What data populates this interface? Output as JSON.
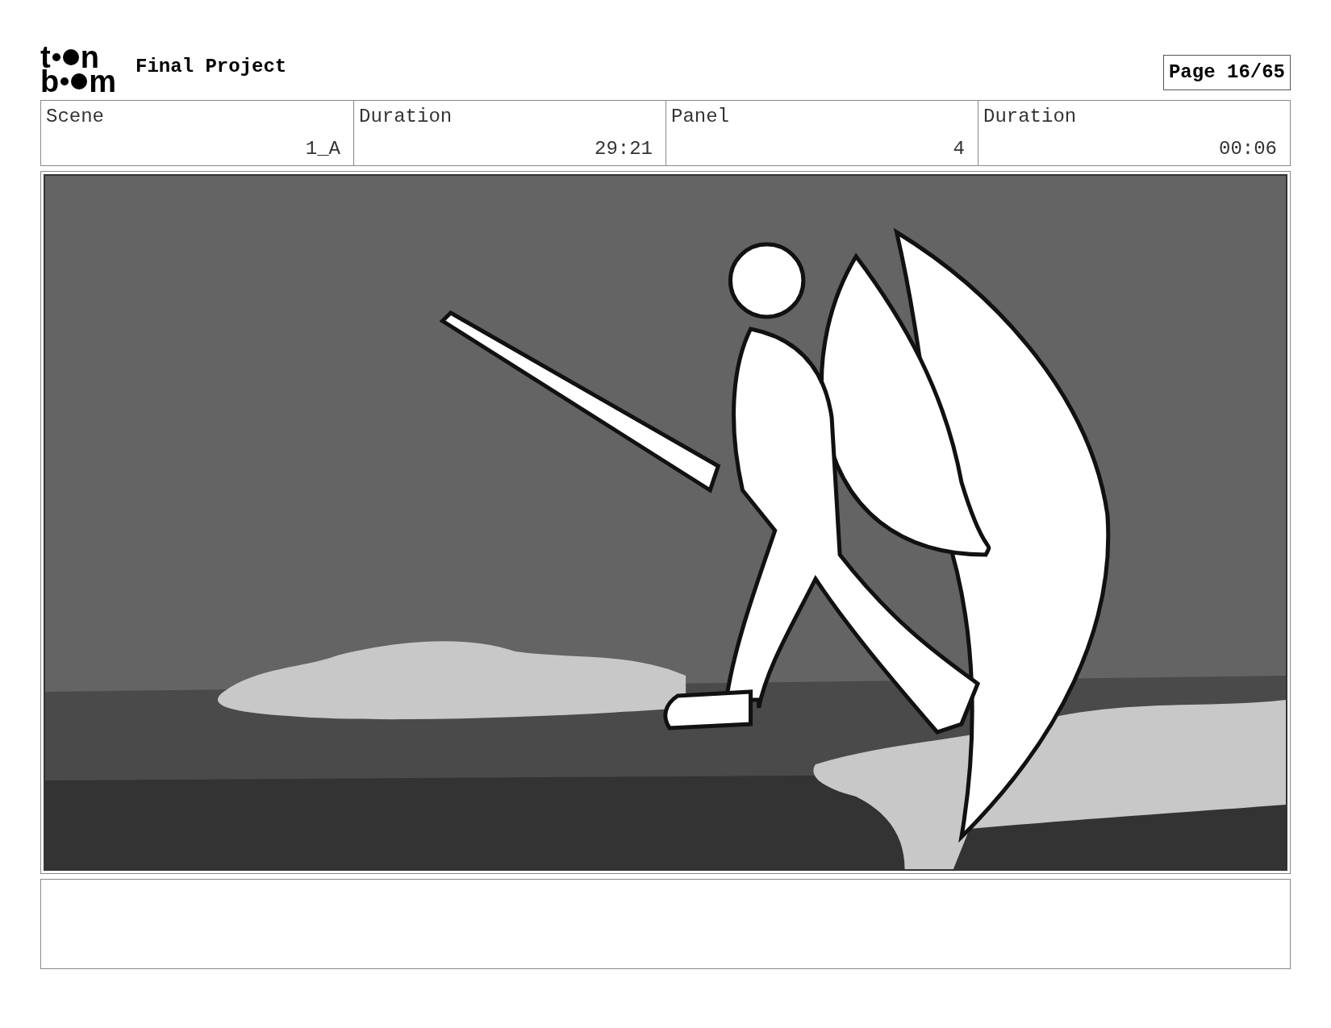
{
  "logo": {
    "top": [
      "t",
      "n"
    ],
    "bottom": [
      "b",
      "m"
    ]
  },
  "project_title": "Final Project",
  "page": "Page 16/65",
  "info": [
    {
      "label": "Scene",
      "value": "1_A"
    },
    {
      "label": "Duration",
      "value": "29:21"
    },
    {
      "label": "Panel",
      "value": "4"
    },
    {
      "label": "Duration",
      "value": "00:06"
    }
  ]
}
